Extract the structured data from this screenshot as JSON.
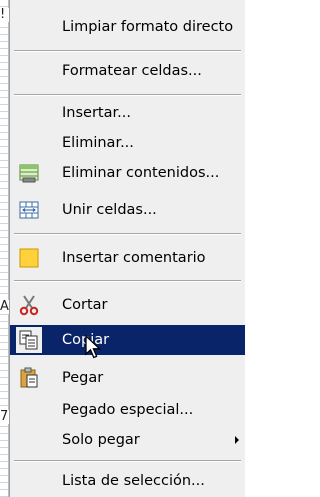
{
  "sheet_fragments": [
    "!",
    "A",
    "7"
  ],
  "menu": {
    "items": [
      {
        "label": "Limpiar formato directo"
      },
      {
        "label": "Formatear celdas..."
      },
      {
        "label": "Insertar..."
      },
      {
        "label": "Eliminar..."
      },
      {
        "label": "Eliminar contenidos..."
      },
      {
        "label": "Unir celdas..."
      },
      {
        "label": "Insertar comentario"
      },
      {
        "label": "Cortar"
      },
      {
        "label": "Copiar"
      },
      {
        "label": "Pegar"
      },
      {
        "label": "Pegado especial..."
      },
      {
        "label": "Solo pegar"
      },
      {
        "label": "Lista de selección..."
      }
    ],
    "highlight_color": "#0a246a"
  }
}
